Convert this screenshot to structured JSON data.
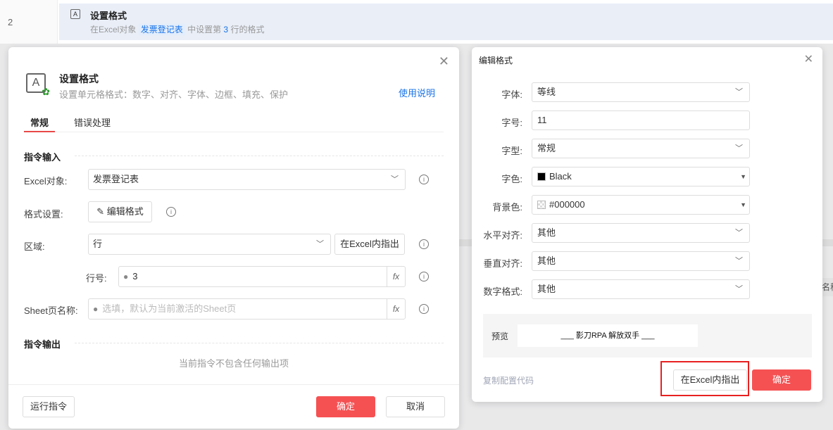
{
  "background": {
    "row_number": "2",
    "row_title": "设置格式",
    "row_desc_prefix": "在Excel对象",
    "row_desc_link": "发票登记表",
    "row_desc_mid": "中设置第",
    "row_desc_num": "3",
    "row_desc_suffix": "行的格式",
    "partial_column": "名称"
  },
  "main_dialog": {
    "title": "设置格式",
    "subtitle": "设置单元格格式：数字、对齐、字体、边框、填充、保护",
    "help_link": "使用说明",
    "tabs": [
      {
        "label": "常规",
        "active": true
      },
      {
        "label": "错误处理",
        "active": false
      }
    ],
    "section_input": "指令输入",
    "excel_label": "Excel对象:",
    "excel_value": "发票登记表",
    "format_label": "格式设置:",
    "edit_format_button": "编辑格式",
    "region_label": "区域:",
    "region_value": "行",
    "locate_button": "在Excel内指出",
    "row_label": "行号:",
    "row_value": "3",
    "sheet_label": "Sheet页名称:",
    "sheet_placeholder": "选填，默认为当前激活的Sheet页",
    "fx": "fx",
    "section_output": "指令输出",
    "no_output": "当前指令不包含任何输出项",
    "run_button": "运行指令",
    "ok_button": "确定",
    "cancel_button": "取消"
  },
  "format_dialog": {
    "title": "编辑格式",
    "fields": [
      {
        "label": "字体:",
        "value": "等线",
        "type": "select"
      },
      {
        "label": "字号:",
        "value": "11",
        "type": "input"
      },
      {
        "label": "字型:",
        "value": "常规",
        "type": "select"
      },
      {
        "label": "字色:",
        "value": "Black",
        "type": "color"
      },
      {
        "label": "背景色:",
        "value": "#000000",
        "type": "color"
      },
      {
        "label": "水平对齐:",
        "value": "其他",
        "type": "select"
      },
      {
        "label": "垂直对齐:",
        "value": "其他",
        "type": "select"
      },
      {
        "label": "数字格式:",
        "value": "其他",
        "type": "select"
      }
    ],
    "preview_label": "预览",
    "preview_text": "___ 影刀RPA 解放双手 ___",
    "copy_code": "复制配置代码",
    "locate_button": "在Excel内指出",
    "ok_button": "确定"
  },
  "colors": {
    "accent": "#f55153",
    "link": "#1a73e8",
    "highlight_box": "#e82020"
  }
}
